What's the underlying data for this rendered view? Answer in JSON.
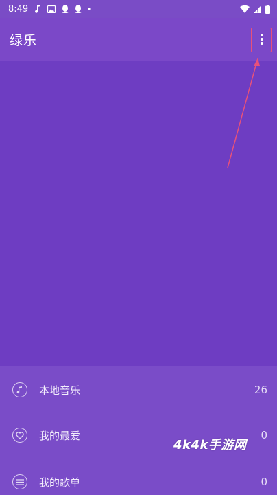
{
  "status_bar": {
    "time": "8:49",
    "left_icons": [
      "music-note-icon",
      "image-icon",
      "qq-icon",
      "qq-icon",
      "dot-icon"
    ],
    "right_icons": [
      "wifi-icon",
      "signal-icon",
      "battery-icon"
    ]
  },
  "app_bar": {
    "title": "绿乐",
    "more_icon": "more-vert-icon"
  },
  "list": [
    {
      "label": "本地音乐",
      "count": "26",
      "icon": "music-disc-icon"
    },
    {
      "label": "我的最爱",
      "count": "0",
      "icon": "heart-icon"
    },
    {
      "label": "我的歌单",
      "count": "0",
      "icon": "playlist-icon"
    }
  ],
  "watermark": "4k4k手游网",
  "colors": {
    "status_bar": "#7a4cc6",
    "app_bar": "#7b48c8",
    "hero": "#6e3dc2",
    "list_bg": "#7a4cc8",
    "annotation": "#e8517a"
  }
}
